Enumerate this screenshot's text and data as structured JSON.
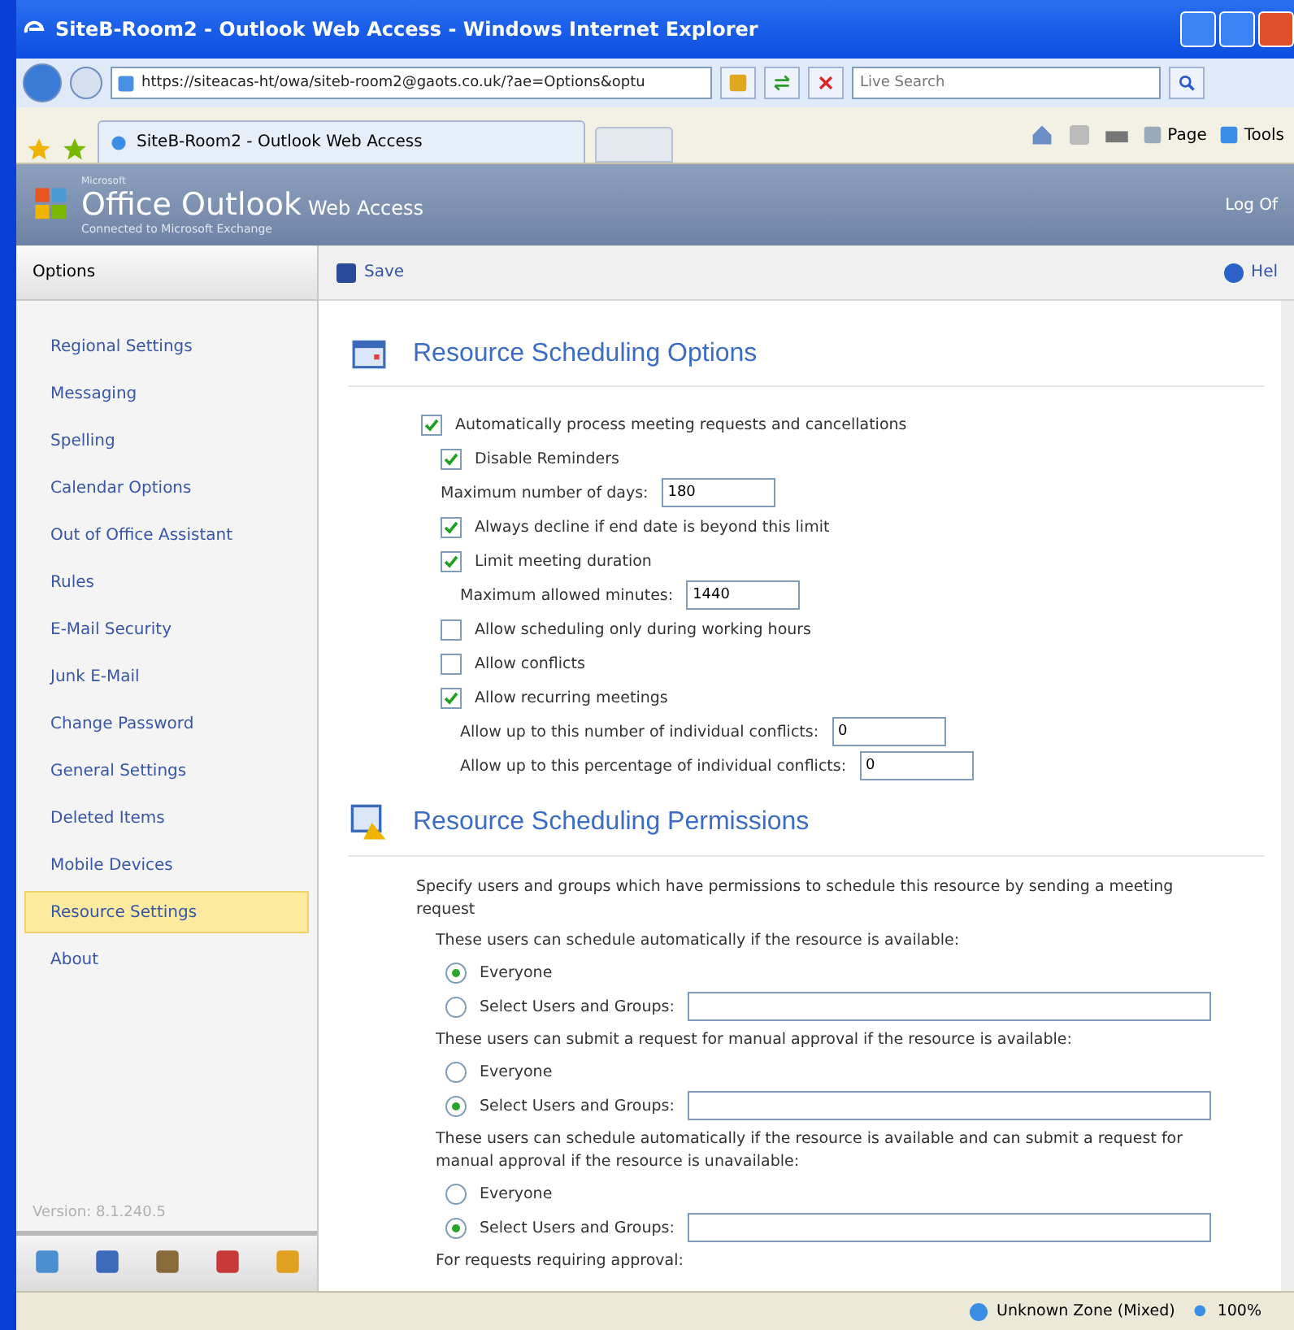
{
  "window": {
    "title": "SiteB-Room2 - Outlook Web Access - Windows Internet Explorer"
  },
  "browser": {
    "address": "https://siteacas-ht/owa/siteb-room2@gaots.co.uk/?ae=Options&optu",
    "search_placeholder": "Live Search",
    "tab": "SiteB-Room2 - Outlook Web Access",
    "commands": [
      "Page",
      "Tools"
    ]
  },
  "header": {
    "vendor": "Microsoft",
    "brand": "Office Outlook",
    "product": "Web Access",
    "subtitle": "Connected to Microsoft Exchange",
    "logoff": "Log Of"
  },
  "sidebar": {
    "title": "Options",
    "items": [
      {
        "label": "Regional Settings",
        "selected": false
      },
      {
        "label": "Messaging",
        "selected": false
      },
      {
        "label": "Spelling",
        "selected": false
      },
      {
        "label": "Calendar Options",
        "selected": false
      },
      {
        "label": "Out of Office Assistant",
        "selected": false
      },
      {
        "label": "Rules",
        "selected": false
      },
      {
        "label": "E-Mail Security",
        "selected": false
      },
      {
        "label": "Junk E-Mail",
        "selected": false
      },
      {
        "label": "Change Password",
        "selected": false
      },
      {
        "label": "General Settings",
        "selected": false
      },
      {
        "label": "Deleted Items",
        "selected": false
      },
      {
        "label": "Mobile Devices",
        "selected": false
      },
      {
        "label": "Resource Settings",
        "selected": true
      },
      {
        "label": "About",
        "selected": false
      }
    ],
    "version": "Version: 8.1.240.5"
  },
  "toolbar": {
    "save": "Save",
    "help": "Hel"
  },
  "options": {
    "title": "Resource Scheduling Options",
    "items": [
      {
        "kind": "checkbox",
        "label": "Automatically process meeting requests and cancellations",
        "checked": true,
        "children": [
          {
            "kind": "checkbox",
            "label": "Disable Reminders",
            "checked": true
          },
          {
            "kind": "field",
            "label": "Maximum number of days:",
            "value": "180"
          },
          {
            "kind": "checkbox",
            "label": "Always decline if end date is beyond this limit",
            "checked": true
          },
          {
            "kind": "checkbox",
            "label": "Limit meeting duration",
            "checked": true,
            "children": [
              {
                "kind": "field",
                "label": "Maximum allowed minutes:",
                "value": "1440"
              }
            ]
          },
          {
            "kind": "checkbox",
            "label": "Allow scheduling only during working hours",
            "checked": false
          },
          {
            "kind": "checkbox",
            "label": "Allow conflicts",
            "checked": false
          },
          {
            "kind": "checkbox",
            "label": "Allow recurring meetings",
            "checked": true,
            "children": [
              {
                "kind": "field",
                "label": "Allow up to this number of individual conflicts:",
                "value": "0"
              },
              {
                "kind": "field",
                "label": "Allow up to this percentage of individual conflicts:",
                "value": "0"
              }
            ]
          }
        ]
      }
    ]
  },
  "permissions": {
    "title": "Resource Scheduling Permissions",
    "description": "Specify users and groups which have permissions to schedule this resource by sending a meeting request",
    "groups": [
      {
        "prompt": "These users can schedule automatically if the resource is available:",
        "options": [
          {
            "label": "Everyone",
            "selected": true
          },
          {
            "label": "Select Users and Groups:",
            "selected": false,
            "kind": "field"
          }
        ]
      },
      {
        "prompt": "These users can submit a request for manual approval if the resource is available:",
        "options": [
          {
            "label": "Everyone",
            "selected": false
          },
          {
            "label": "Select Users and Groups:",
            "selected": true,
            "kind": "field"
          }
        ]
      },
      {
        "prompt": "These users can schedule automatically if the resource is available and can submit a request for manual approval if the resource is unavailable:",
        "options": [
          {
            "label": "Everyone",
            "selected": false
          },
          {
            "label": "Select Users and Groups:",
            "selected": true,
            "kind": "field"
          }
        ]
      },
      {
        "prompt": "For requests requiring approval:"
      }
    ]
  },
  "status_bar": {
    "zone": "Unknown Zone (Mixed)",
    "zoom": "100%"
  }
}
